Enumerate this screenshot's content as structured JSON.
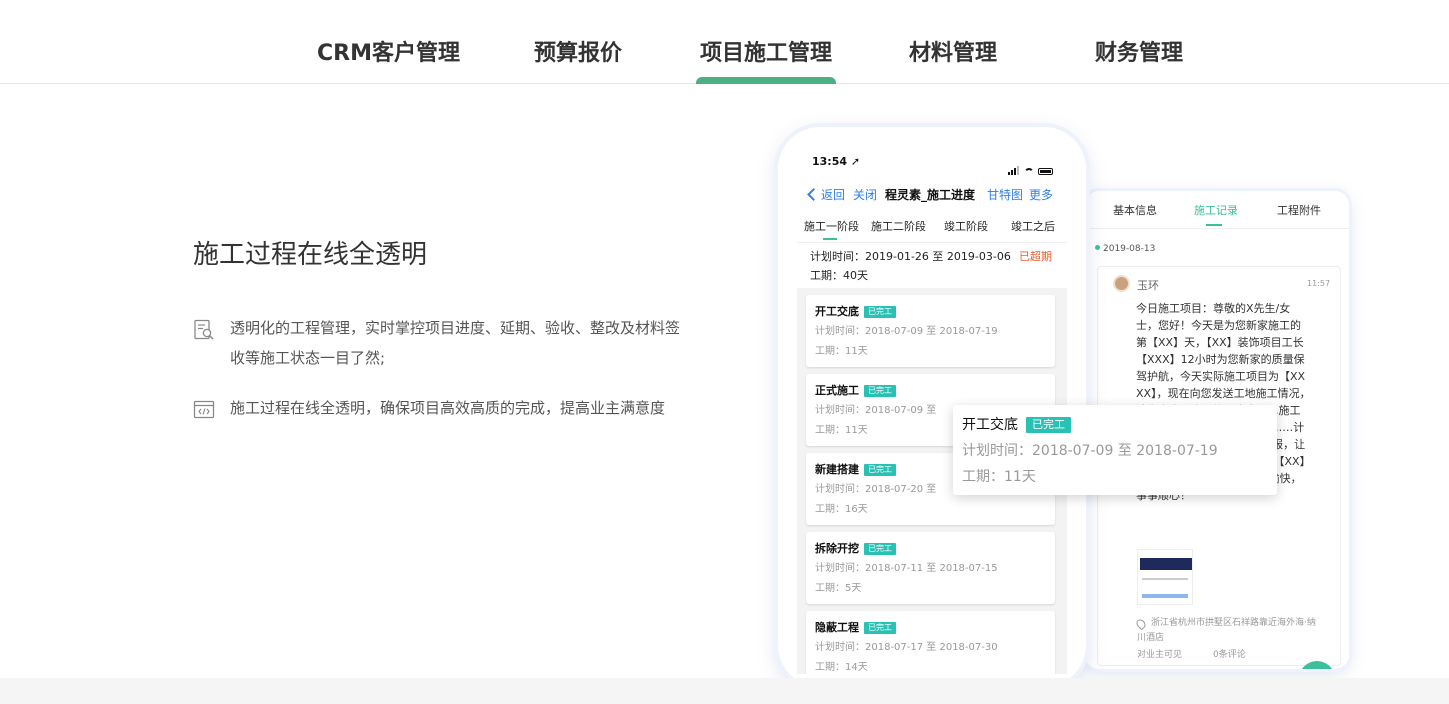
{
  "nav": {
    "tabs": [
      {
        "label": "CRM客户管理"
      },
      {
        "label": "预算报价"
      },
      {
        "label": "项目施工管理"
      },
      {
        "label": "材料管理"
      },
      {
        "label": "财务管理"
      }
    ],
    "active_tab": "项目施工管理",
    "accent_color": "#4caf83"
  },
  "left": {
    "heading": "施工过程在线全透明",
    "features": [
      {
        "icon": "search-document-icon",
        "text": "透明化的工程管理，实时掌控项目进度、延期、验收、整改及材料签收等施工状态一目了然;"
      },
      {
        "icon": "code-window-icon",
        "text": "施工过程在线全透明，确保项目高效高质的完成，提高业主满意度"
      }
    ]
  },
  "phone": {
    "status": {
      "time": "13:54 ➚"
    },
    "nav": {
      "back": "返回",
      "close": "关闭",
      "title": "程灵素_施工进度",
      "gantt": "甘特图",
      "more": "更多"
    },
    "stages": [
      "施工一阶段",
      "施工二阶段",
      "竣工阶段",
      "竣工之后"
    ],
    "active_stage": "施工一阶段",
    "plan": "计划时间：2019-01-26 至 2019-03-06",
    "overdue": "已超期",
    "days": "工期：40天",
    "tasks": [
      {
        "title": "开工交底",
        "badge": "已完工",
        "plan": "计划时间：2018-07-09 至 2018-07-19",
        "days": "工期：11天"
      },
      {
        "title": "正式施工",
        "badge": "已完工",
        "plan": "计划时间：2018-07-09 至",
        "days": "工期：11天"
      },
      {
        "title": "新建搭建",
        "badge": "已完工",
        "plan": "计划时间：2018-07-20 至",
        "days": "工期：16天"
      },
      {
        "title": "拆除开挖",
        "badge": "已完工",
        "plan": "计划时间：2018-07-11 至 2018-07-15",
        "days": "工期：5天"
      },
      {
        "title": "隐蔽工程",
        "badge": "已完工",
        "plan": "计划时间：2018-07-17 至 2018-07-30",
        "days": "工期：14天"
      }
    ],
    "badge_color": "#29c1b4",
    "link_color": "#2f7fe6",
    "overdue_color": "#f05a2a"
  },
  "popup": {
    "title": "开工交底",
    "badge": "已完工",
    "plan": "计划时间：2018-07-09 至 2018-07-19",
    "days": "工期：11天"
  },
  "record": {
    "tabs": [
      "基本信息",
      "施工记录",
      "工程附件"
    ],
    "active_tab": "施工记录",
    "date": "2019-08-13",
    "author": "玉环",
    "time": "11:57",
    "message": "今日施工项目：尊敬的X先生/女士，您好！今天是为您新家施工的第【XX】天，【XX】装饰项目工长【XXX】12小时为您新家的质量保驾护航，今天实际施工项目为【XXXX】，现在向您发送工地施工情况，请您查收。今日施工内容：1.施工前准备；2.施工……先生/女……计划如下……【XX】工作……报，让您了解工地动态，请您放心。【XX】装饰项目经理XXX祝你生活愉快，事事顺心！",
    "location": "浙江省杭州市拱墅区石祥路靠近海外海·纳川酒店",
    "visibility": "对业主可见",
    "comments": "0条评论",
    "accent_color": "#3cbf9a"
  }
}
